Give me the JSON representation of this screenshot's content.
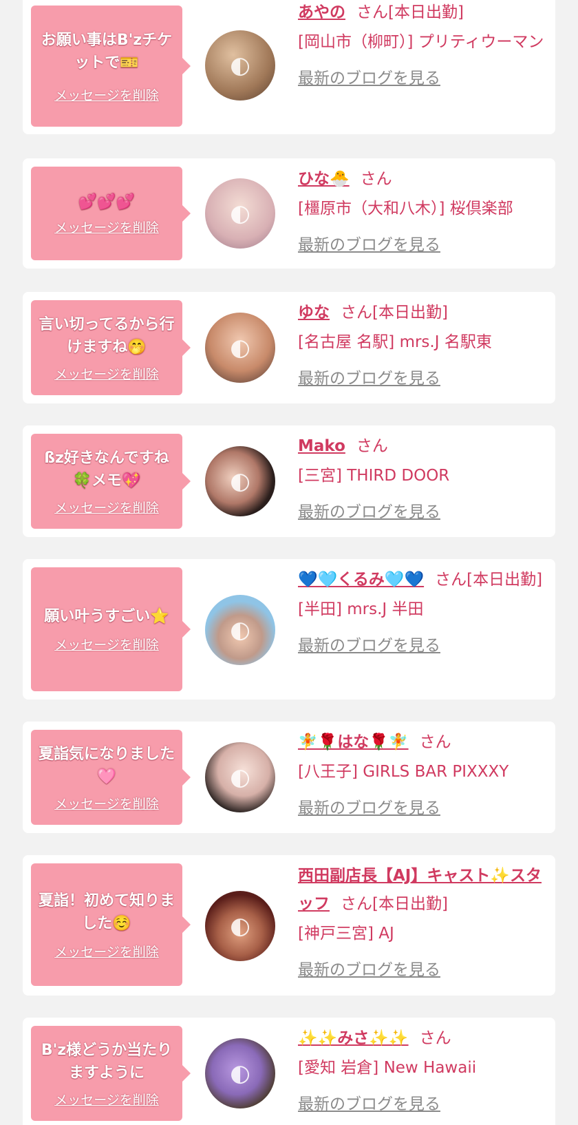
{
  "san_label": "さん",
  "delete_label": "メッセージを削除",
  "blog_label": "最新のブログを見る",
  "items": [
    {
      "message": "お願い事はB'zチケットで🎫",
      "name": "あやの",
      "status": "[本日出勤]",
      "shop": "[岡山市（柳町）] プリティウーマン",
      "avatar_color": "#a07858"
    },
    {
      "message": "💕💕💕",
      "name": "ひな🐣",
      "status": "",
      "shop": "[橿原市（大和八木）] 桜倶楽部",
      "avatar_color": "#e6c6c6"
    },
    {
      "message": "言い切ってるから行けますね🤭",
      "name": "ゆな",
      "status": "[本日出勤]",
      "shop": "[名古屋 名駅] mrs.J 名駅東",
      "avatar_color": "#c88a6a"
    },
    {
      "message": "ßz好きなんですね🍀メモ💖",
      "name": "Mako",
      "status": "",
      "shop": "[三宮] THIRD DOOR",
      "avatar_color": "#3a2a28"
    },
    {
      "message": "願い叶うすごい⭐",
      "name": "💙🩵くるみ🩵💙",
      "status": "[本日出勤]",
      "shop": "[半田] mrs.J 半田",
      "avatar_color": "#8fc4e6"
    },
    {
      "message": "夏詣気になりました🩷",
      "name": "🧚🌹はな🌹🧚",
      "status": "",
      "shop": "[八王子] GIRLS BAR PIXXXY",
      "avatar_color": "#d6b0a8"
    },
    {
      "message": "夏詣！初めて知りました☺️",
      "name": "西田副店長【AJ】キャスト✨スタッフ",
      "status": "[本日出勤]",
      "shop": "[神戸三宮] AJ",
      "avatar_color": "#8a3a2a"
    },
    {
      "message": "B'z様どうか当たりますように",
      "name": "✨✨みさ✨✨",
      "status": "",
      "shop": "[愛知 岩倉] New Hawaii",
      "avatar_color": "#8a6ab8"
    }
  ]
}
